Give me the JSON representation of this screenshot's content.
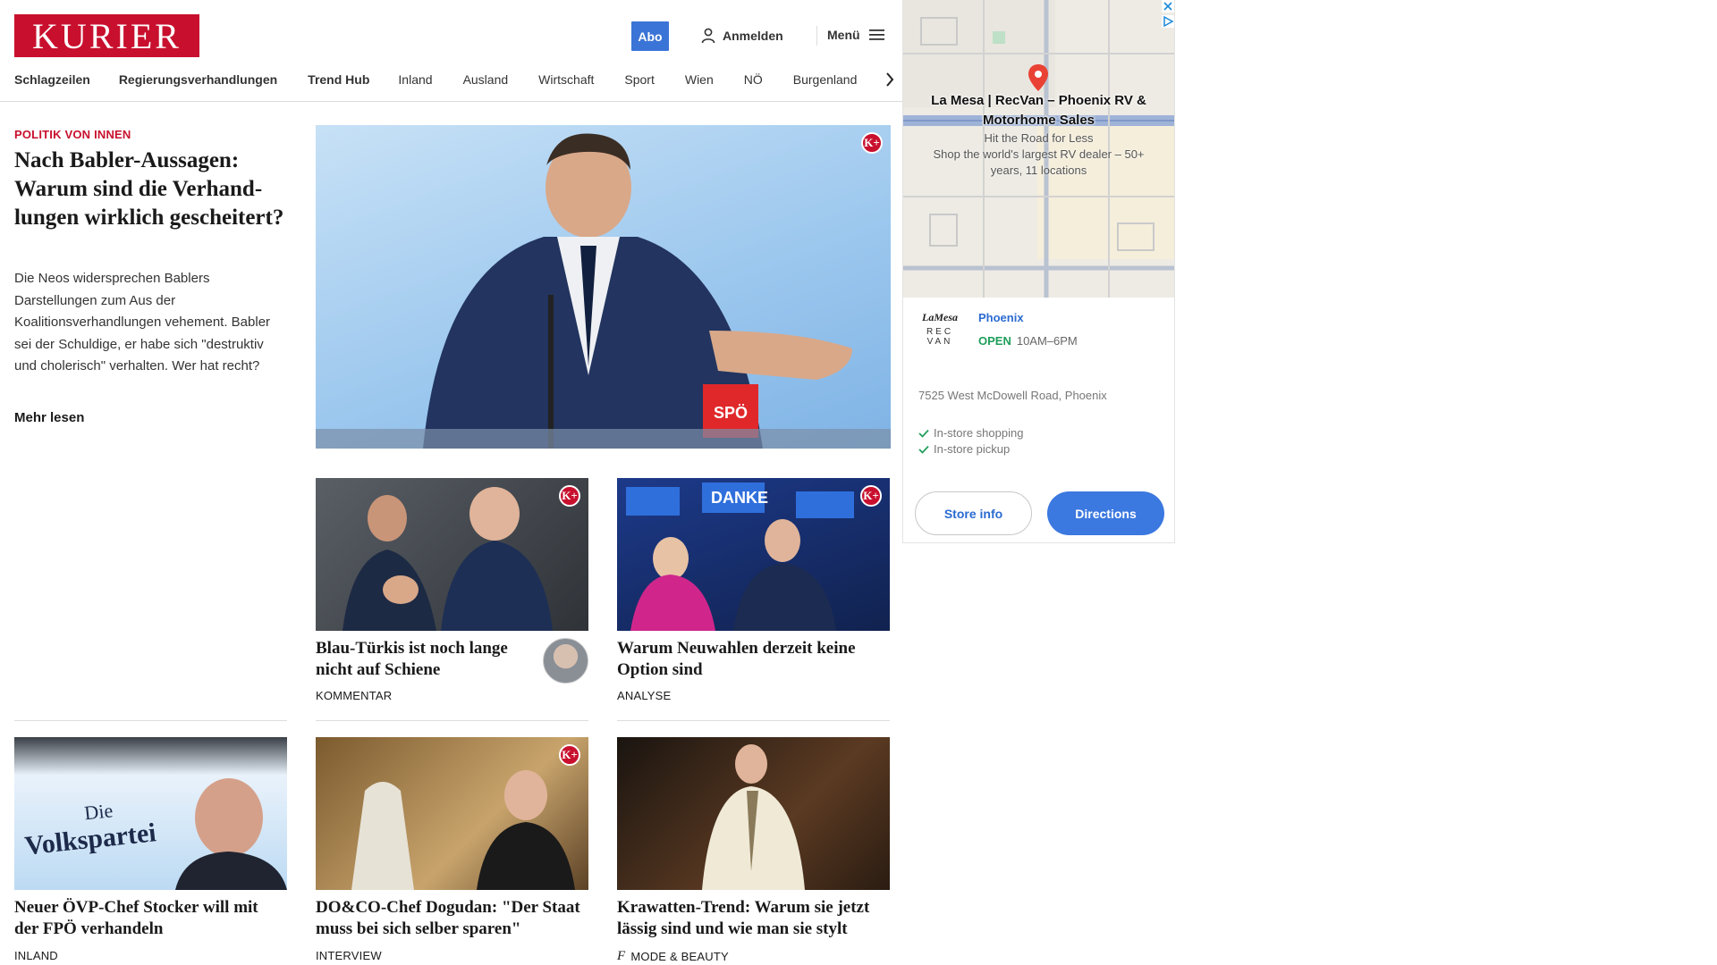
{
  "header": {
    "logo": "KURIER",
    "abo": "Abo",
    "login": "Anmelden",
    "menu": "Menü"
  },
  "nav": {
    "items": [
      "Schlagzeilen",
      "Regierungsverhandlungen",
      "Trend Hub",
      "Inland",
      "Ausland",
      "Wirtschaft",
      "Sport",
      "Wien",
      "NÖ",
      "Burgenland"
    ]
  },
  "lead": {
    "kicker": "POLITIK VON INNEN",
    "title": "Nach Babler-Aussagen: Warum sind die Verhand-lungen wirklich gescheitert?",
    "description": "Die Neos widersprechen Bablers Darstellungen zum Aus der Koalitionsverhandlungen vehement. Babler sei der Schuldige, er habe sich \"destruktiv und cholerisch\" verhalten. Wer hat recht?",
    "read_more": "Mehr lesen",
    "badge": "K+",
    "podium_label": "SPÖ"
  },
  "cards": [
    {
      "title": "Blau-Türkis ist noch lange nicht auf Schiene",
      "tag": "KOMMENTAR",
      "badge": "K+"
    },
    {
      "title": "Warum Neuwahlen derzeit keine Option sind",
      "tag": "ANALYSE",
      "badge": "K+",
      "sign_text": "DANKE"
    },
    {
      "title": "Neuer ÖVP-Chef Stocker will mit der FPÖ verhandeln",
      "tag": "INLAND",
      "backdrop_text_1": "Die",
      "backdrop_text_2": "Volkspartei"
    },
    {
      "title": "DO&CO-Chef Dogudan: \"Der Staat muss bei sich selber sparen\"",
      "tag": "INTERVIEW",
      "badge": "K+"
    },
    {
      "title": "Krawatten-Trend: Warum sie jetzt lässig sind und wie man sie stylt",
      "tag": "MODE & BEAUTY",
      "tag_icon": "f"
    }
  ],
  "ad": {
    "title": "La Mesa | RecVan – Phoenix RV & Motorhome Sales",
    "subtitle_1": "Hit the Road for Less",
    "subtitle_2": "Shop the world's largest RV dealer – 50+ years, 11 locations",
    "logo_line_1": "LaMesa",
    "logo_line_2": "REC",
    "logo_line_3": "VAN",
    "store": "Phoenix",
    "open": "OPEN",
    "hours": "10AM–6PM",
    "address": "7525 West McDowell Road, Phoenix",
    "features": [
      "In-store shopping",
      "In-store pickup"
    ],
    "store_info": "Store info",
    "directions": "Directions",
    "colors": {
      "brand": "#c8102e",
      "ad_blue": "#3b78e0",
      "open_green": "#1e9e5a"
    }
  }
}
